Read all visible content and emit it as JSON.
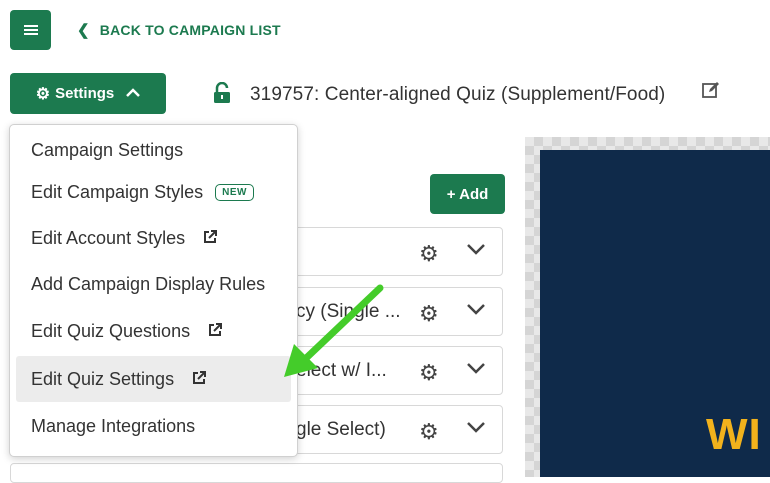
{
  "header": {
    "back_link": "BACK TO CAMPAIGN LIST",
    "settings_label": "Settings",
    "campaign_title": "319757: Center-aligned Quiz (Supplement/Food)"
  },
  "toolbar": {
    "add_label": "+ Add"
  },
  "rows": [
    {
      "label": ""
    },
    {
      "label": "cy (Single ..."
    },
    {
      "label": "elect w/ I..."
    },
    {
      "label": "gle Select)"
    }
  ],
  "menu": {
    "items": [
      {
        "label": "Campaign Settings"
      },
      {
        "label": "Edit Campaign Styles",
        "badge": "NEW"
      },
      {
        "label": "Edit Account Styles"
      },
      {
        "label": "Add Campaign Display Rules"
      },
      {
        "label": "Edit Quiz Questions"
      },
      {
        "label": "Edit Quiz Settings"
      },
      {
        "label": "Manage Integrations"
      }
    ]
  },
  "preview": {
    "text": "WI"
  },
  "colors": {
    "brand": "#1c7a4f",
    "arrow": "#44cc2a",
    "preview_bg": "#0f2a4a",
    "preview_text": "#f2b21c"
  },
  "icons": [
    "hamburger-icon",
    "chevron-left-icon",
    "gear-icon",
    "chevron-up-icon",
    "unlock-icon",
    "pencil-icon",
    "external-link-icon",
    "chevron-down-icon"
  ]
}
